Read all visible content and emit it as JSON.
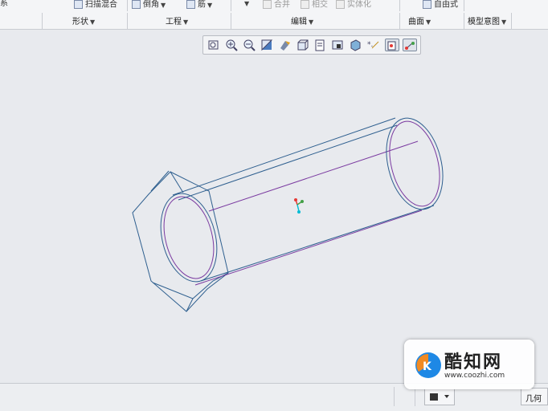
{
  "ribbon": {
    "top_items": [
      {
        "label": "系"
      },
      {
        "label": "扫描混合"
      },
      {
        "label": "倒角"
      },
      {
        "label": "筋"
      },
      {
        "label": "合并"
      },
      {
        "label": "相交"
      },
      {
        "label": "实体化"
      },
      {
        "label": "自由式"
      }
    ],
    "groups": [
      {
        "label": "形状"
      },
      {
        "label": "工程"
      },
      {
        "label": "编辑"
      },
      {
        "label": "曲面"
      },
      {
        "label": "模型意图"
      }
    ]
  },
  "view_toolbar": {
    "tools": [
      "refit-icon",
      "zoom-in-icon",
      "zoom-out-icon",
      "repaint-icon",
      "display-style-icon",
      "saved-views-icon",
      "view-manager-icon",
      "perspective-view-icon",
      "appearance-icon",
      "datum-display-icon",
      "spin-center-icon",
      "annotation-display-icon"
    ]
  },
  "model": {
    "type": "hex nut with cylindrical tube, wireframe"
  },
  "statusbar": {
    "filter_value": "几何",
    "mini_icon": "selection-filter-icon"
  },
  "watermark": {
    "brand": "酷知网",
    "url": "www.coozhi.com"
  },
  "colors": {
    "model_edge": "#2e5f8f",
    "model_inner": "#7a3aa0",
    "background": "#e8eaee",
    "brand_orange": "#f08a24",
    "brand_blue": "#1e88e5"
  }
}
